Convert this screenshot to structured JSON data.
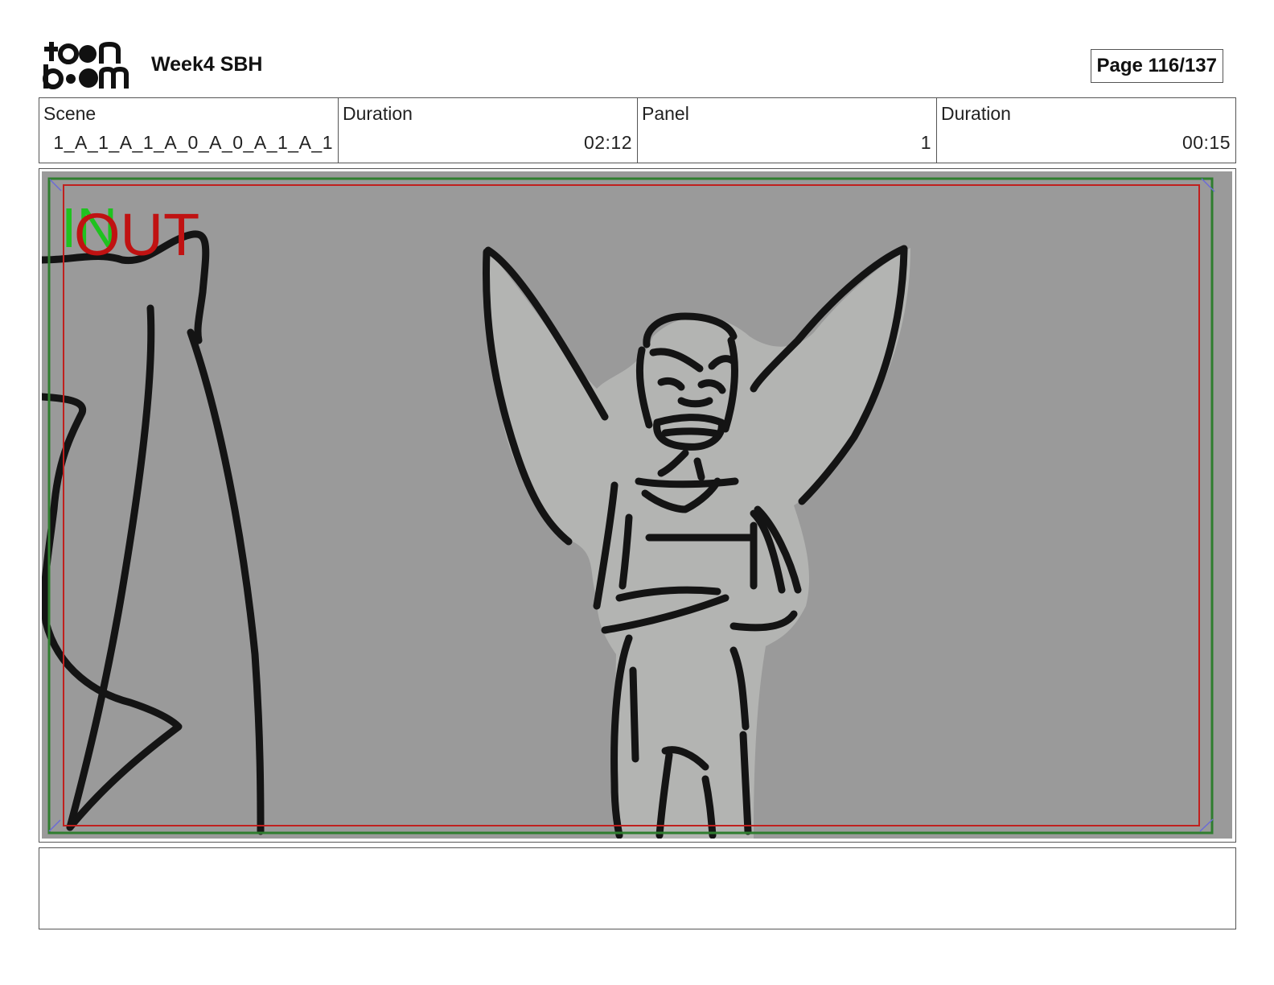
{
  "header": {
    "logo_icon": "toon-boom-logo",
    "project_title": "Week4 SBH",
    "page_label": "Page 116/137"
  },
  "info": {
    "scene_label": "Scene",
    "scene_value": "1_A_1_A_1_A_0_A_0_A_1_A_1",
    "scene_duration_label": "Duration",
    "scene_duration_value": "02:12",
    "panel_label": "Panel",
    "panel_value": "1",
    "panel_duration_label": "Duration",
    "panel_duration_value": "00:15"
  },
  "panel": {
    "in_marker": "IN",
    "out_marker": "OUT",
    "colors": {
      "background": "#9a9a9a",
      "figure_fill": "#b3b4b2",
      "ink": "#141414",
      "safe_frame_green": "#2f7d2f",
      "action_frame_red": "#c0201e",
      "in_green": "#1fc21f",
      "out_red": "#c01212"
    }
  },
  "notes": {
    "text": ""
  }
}
